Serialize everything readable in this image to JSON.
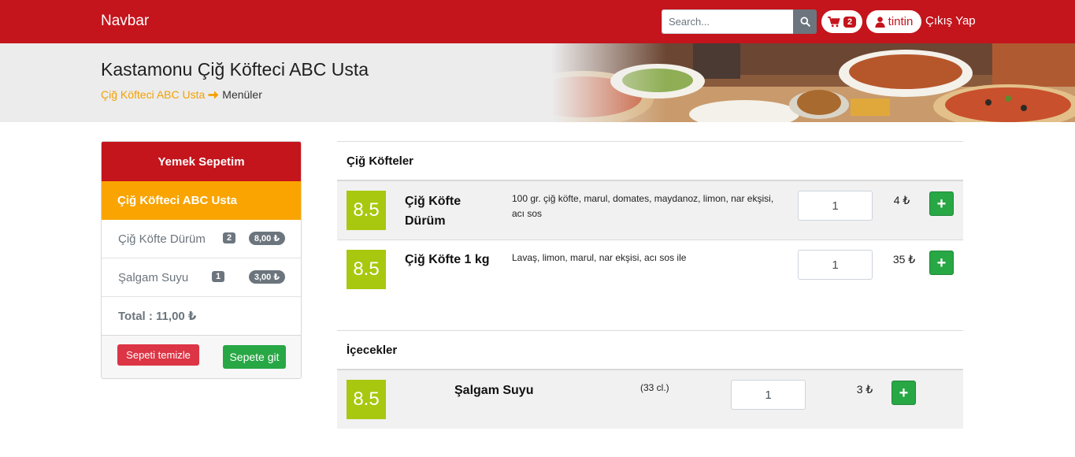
{
  "navbar": {
    "brand": "Navbar",
    "search_placeholder": "Search...",
    "cart_count": "2",
    "user": "tintin",
    "logout": "Çıkış Yap"
  },
  "header": {
    "title": "Kastamonu Çiğ Köfteci ABC Usta",
    "breadcrumb_link": "Çiğ Köfteci ABC Usta",
    "breadcrumb_current": "Menüler"
  },
  "cart": {
    "title": "Yemek Sepetim",
    "shop": "Çiğ Köfteci ABC Usta",
    "items": [
      {
        "name": "Çiğ Köfte Dürüm",
        "qty": "2",
        "price": "8,00 ₺"
      },
      {
        "name": "Şalgam Suyu",
        "qty": "1",
        "price": "3,00 ₺"
      }
    ],
    "total": "Total : 11,00 ₺",
    "clear_label": "Sepeti temizle",
    "go_label": "Sepete git"
  },
  "menu": {
    "sections": [
      {
        "title": "Çiğ Köfteler",
        "items": [
          {
            "score": "8.5",
            "name": "Çiğ Köfte Dürüm",
            "desc": "100 gr. çiğ köfte, marul, domates, maydanoz, limon, nar ekşisi, acı sos",
            "qty": "1",
            "price": "4 ₺",
            "add": "+"
          },
          {
            "score": "8.5",
            "name": "Çiğ Köfte 1 kg",
            "desc": "Lavaş, limon, marul, nar ekşisi, acı sos ile",
            "qty": "1",
            "price": "35 ₺",
            "add": "+"
          }
        ]
      },
      {
        "title": "İçecekler",
        "items": [
          {
            "score": "8.5",
            "name": "Şalgam Suyu",
            "desc": "(33 cl.)",
            "qty": "1",
            "price": "3 ₺",
            "add": "+"
          }
        ]
      }
    ]
  },
  "colors": {
    "brand_red": "#c4141c",
    "orange": "#f9a400",
    "green": "#28a745",
    "score_green": "#a7c80f"
  }
}
